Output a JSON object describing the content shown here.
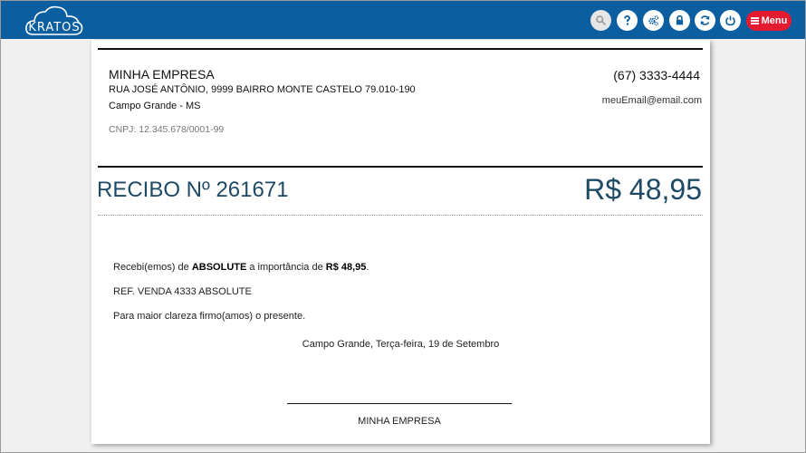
{
  "header": {
    "logo_text": "KRATOS",
    "buttons": [
      {
        "name": "search",
        "icon": "search-icon"
      },
      {
        "name": "help",
        "icon": "question-icon"
      },
      {
        "name": "settings",
        "icon": "gears-icon"
      },
      {
        "name": "lock",
        "icon": "lock-icon"
      },
      {
        "name": "refresh",
        "icon": "refresh-icon"
      },
      {
        "name": "power",
        "icon": "power-icon"
      }
    ],
    "menu_label": "Menu",
    "colors": {
      "bar": "#0b5fa0",
      "menu": "#e41b2e"
    }
  },
  "company": {
    "name": "MINHA EMPRESA",
    "address": "RUA JOSÉ ANTÔNIO, 9999 BAIRRO MONTE CASTELO 79.010-190",
    "city": "Campo Grande - MS",
    "cnpj": "CNPJ: 12.345.678/0001-99",
    "phone": "(67) 3333-4444",
    "email": "meuEmail@email.com"
  },
  "receipt": {
    "title": "RECIBO Nº 261671",
    "value": "R$ 48,95",
    "text_prefix": "Recebi(emos) de ",
    "payer": "ABSOLUTE",
    "text_middle": " a importância de ",
    "amount": "R$ 48,95",
    "text_suffix": ".",
    "reference": "REF. VENDA 4333 ABSOLUTE",
    "clarity": "Para maior clareza firmo(amos) o presente.",
    "place_date": "Campo Grande, Terça-feira, 19 de Setembro",
    "signature": "MINHA EMPRESA",
    "accent_color": "#1e4a66"
  }
}
